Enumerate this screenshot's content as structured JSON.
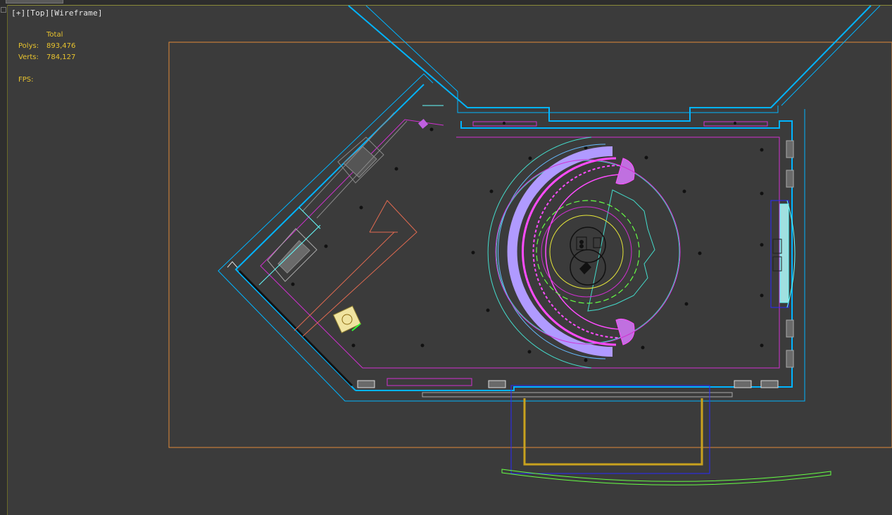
{
  "viewport": {
    "label_plus": "[+]",
    "label_view": "[Top]",
    "label_mode": "[Wireframe]"
  },
  "stats": {
    "header": "Total",
    "polys_label": "Polys:",
    "polys_value": "893,476",
    "verts_label": "Verts:",
    "verts_value": "784,127",
    "fps_label": "FPS:"
  },
  "colors": {
    "background": "#3b3b3b",
    "stats_text": "#e8c32e",
    "walls": "#00b4ff",
    "outer_frame": "#e08a3a",
    "furniture": "#ff4cff",
    "green_shapes": "#66ff44",
    "gold_frame": "#c8a21e"
  }
}
